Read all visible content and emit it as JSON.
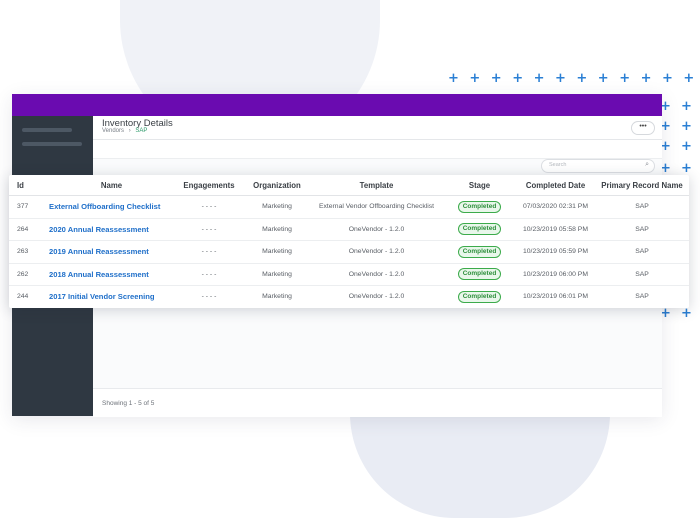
{
  "page": {
    "title": "Inventory Details",
    "breadcrumbs": [
      "Vendors",
      "SAP"
    ],
    "breadcrumb_sep": "›",
    "more_button": "•••",
    "search_placeholder": "Search",
    "footer_text": "Showing 1 - 5 of 5"
  },
  "table": {
    "columns": [
      "Id",
      "Name",
      "Engagements",
      "Organization",
      "Template",
      "Stage",
      "Completed Date",
      "Primary Record Name"
    ],
    "rows": [
      {
        "id": "377",
        "name": "External Offboarding Checklist",
        "engagements": "- - - -",
        "organization": "Marketing",
        "template": "External Vendor Offboarding Checklist",
        "stage": "Completed",
        "completed": "07/03/2020 02:31 PM",
        "record": "SAP"
      },
      {
        "id": "264",
        "name": "2020 Annual Reassessment",
        "engagements": "- - - -",
        "organization": "Marketing",
        "template": "OneVendor - 1.2.0",
        "stage": "Completed",
        "completed": "10/23/2019 05:58 PM",
        "record": "SAP"
      },
      {
        "id": "263",
        "name": "2019 Annual Reassessment",
        "engagements": "- - - -",
        "organization": "Marketing",
        "template": "OneVendor - 1.2.0",
        "stage": "Completed",
        "completed": "10/23/2019 05:59 PM",
        "record": "SAP"
      },
      {
        "id": "262",
        "name": "2018 Annual Reassessment",
        "engagements": "- - - -",
        "organization": "Marketing",
        "template": "OneVendor - 1.2.0",
        "stage": "Completed",
        "completed": "10/23/2019 06:00 PM",
        "record": "SAP"
      },
      {
        "id": "244",
        "name": "2017 Initial Vendor Screening",
        "engagements": "- - - -",
        "organization": "Marketing",
        "template": "OneVendor - 1.2.0",
        "stage": "Completed",
        "completed": "10/23/2019 06:01 PM",
        "record": "SAP"
      }
    ]
  },
  "colors": {
    "topbar": "#6a0bb0",
    "sidebar": "#2f3842",
    "link": "#1f6fc9",
    "badge_green": "#3cab4b",
    "plus": "#2a7fd4"
  },
  "icons": {
    "search": "search-icon",
    "more": "more-icon",
    "plus": "plus-icon"
  }
}
